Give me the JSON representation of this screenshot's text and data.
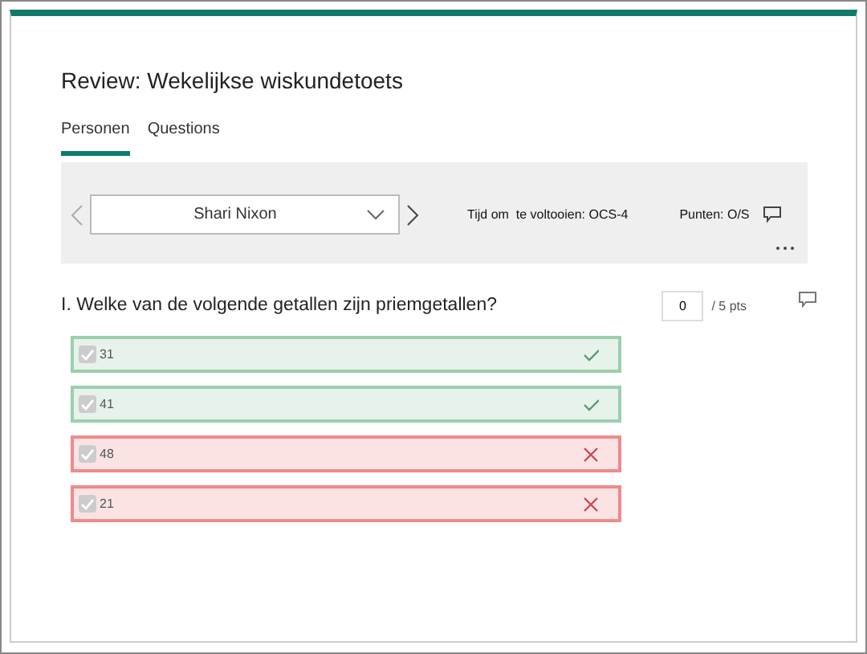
{
  "title": "Review: Wekelijkse wiskundetoets",
  "tabs": [
    {
      "label": "Personen",
      "selected": true
    },
    {
      "label": "Questions",
      "selected": false
    }
  ],
  "respondent": {
    "name": "Shari Nixon",
    "time": "Tijd om  te voltooien: OCS-4",
    "points": "Punten: O/S"
  },
  "question": {
    "text": "I. Welke van de volgende getallen zijn priemgetallen?",
    "score": "0",
    "max": "/ 5 pts",
    "options": [
      {
        "label": "31",
        "checked": true,
        "kind": "correct"
      },
      {
        "label": "41",
        "checked": true,
        "kind": "correct"
      },
      {
        "label": "48",
        "checked": true,
        "kind": "incorrect"
      },
      {
        "label": "21",
        "checked": true,
        "kind": "incorrect"
      }
    ]
  }
}
